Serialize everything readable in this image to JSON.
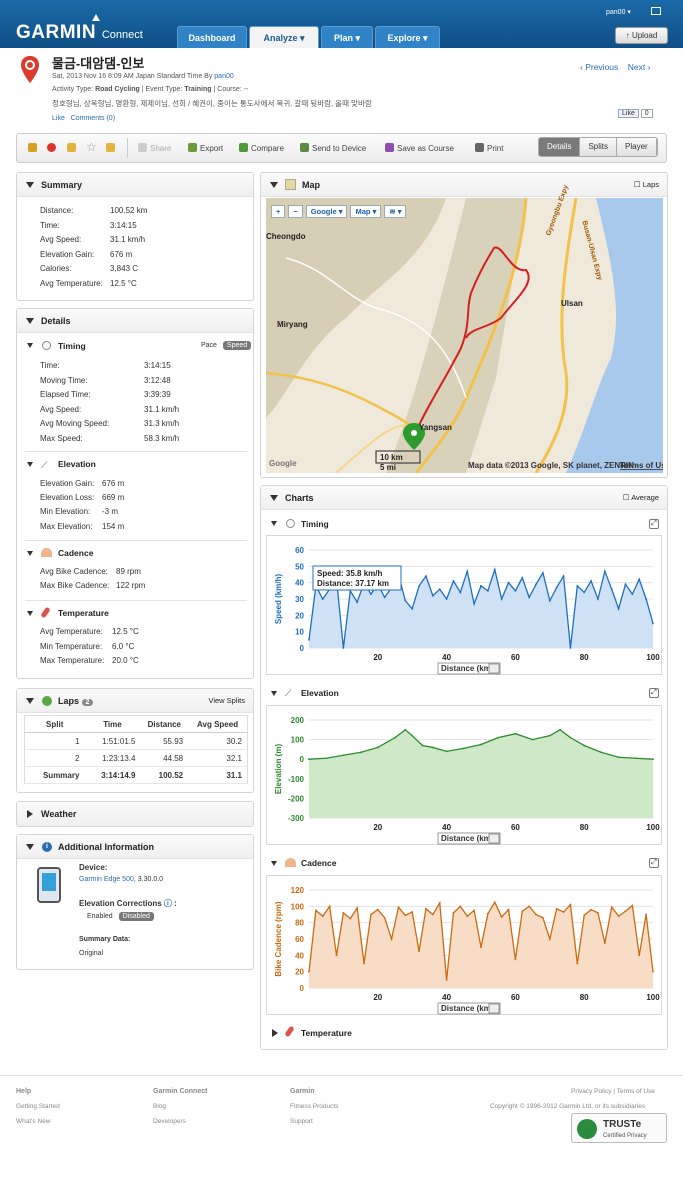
{
  "brand": {
    "name": "GARMIN",
    "product": "Connect"
  },
  "nav": [
    {
      "label": "Dashboard"
    },
    {
      "label": "Analyze"
    },
    {
      "label": "Plan"
    },
    {
      "label": "Explore"
    }
  ],
  "user": "pan00",
  "upload": "Upload",
  "activity": {
    "title": "물금-대암댐-인보",
    "date_line": "Sat, 2013 Nov 16 8:09 AM Japan Standard Time By",
    "owner": "pan00",
    "type_label": "Activity Type:",
    "type": "Road Cycling",
    "event_label": "| Event Type:",
    "event": "Training",
    "course": "| Course: --",
    "tags": "정호형님, 상옥형님, 명환형, 제제이님, 선희 / 혜권이, 중이는 통도사에서 복귀. 갈때 뒷바람, 올때 맞바람",
    "like": "Like",
    "comments": "Comments (0)",
    "prev": "Previous",
    "next": "Next",
    "fb_like": "Like",
    "fb_count": "0"
  },
  "toolbar": {
    "share": "Share",
    "export": "Export",
    "compare": "Compare",
    "send": "Send to Device",
    "save": "Save as Course",
    "print": "Print",
    "tabs": [
      "Details",
      "Splits",
      "Player"
    ]
  },
  "summary": {
    "title": "Summary",
    "rows": [
      {
        "k": "Distance:",
        "v": "100.52 km"
      },
      {
        "k": "Time:",
        "v": "3:14:15"
      },
      {
        "k": "Avg Speed:",
        "v": "31.1 km/h"
      },
      {
        "k": "Elevation Gain:",
        "v": "676 m"
      },
      {
        "k": "Calories:",
        "v": "3,843 C"
      },
      {
        "k": "Avg Temperature:",
        "v": "12.5 °C"
      }
    ]
  },
  "details": {
    "title": "Details",
    "timing": {
      "title": "Timing",
      "pace": "Pace",
      "speed": "Speed",
      "rows": [
        {
          "k": "Time:",
          "v": "3:14:15"
        },
        {
          "k": "Moving Time:",
          "v": "3:12:48"
        },
        {
          "k": "Elapsed Time:",
          "v": "3:39:39"
        },
        {
          "k": "Avg Speed:",
          "v": "31.1 km/h"
        },
        {
          "k": "Avg Moving Speed:",
          "v": "31.3 km/h"
        },
        {
          "k": "Max Speed:",
          "v": "58.3 km/h"
        }
      ]
    },
    "elevation": {
      "title": "Elevation",
      "rows": [
        {
          "k": "Elevation Gain:",
          "v": "676 m"
        },
        {
          "k": "Elevation Loss:",
          "v": "669 m"
        },
        {
          "k": "Min Elevation:",
          "v": "-3 m"
        },
        {
          "k": "Max Elevation:",
          "v": "154 m"
        }
      ]
    },
    "cadence": {
      "title": "Cadence",
      "rows": [
        {
          "k": "Avg Bike Cadence:",
          "v": "89 rpm"
        },
        {
          "k": "Max Bike Cadence:",
          "v": "122 rpm"
        }
      ]
    },
    "temperature": {
      "title": "Temperature",
      "rows": [
        {
          "k": "Avg Temperature:",
          "v": "12.5 °C"
        },
        {
          "k": "Min Temperature:",
          "v": "6.0 °C"
        },
        {
          "k": "Max Temperature:",
          "v": "20.0 °C"
        }
      ]
    }
  },
  "laps": {
    "title": "Laps",
    "count": "2",
    "view": "View Splits",
    "headers": [
      "Split",
      "Time",
      "Distance",
      "Avg Speed"
    ],
    "rows": [
      [
        "1",
        "1:51:01.5",
        "55.93",
        "30.2"
      ],
      [
        "2",
        "1:23:13.4",
        "44.58",
        "32.1"
      ],
      [
        "Summary",
        "3:14:14.9",
        "100.52",
        "31.1"
      ]
    ]
  },
  "weather": {
    "title": "Weather"
  },
  "additional": {
    "title": "Additional Information",
    "device_label": "Device:",
    "device": "Garmin Edge 500",
    "device_ver": ", 3.30.0.0",
    "elev_label": "Elevation Corrections",
    "enabled": "Enabled",
    "disabled": "Disabled",
    "summary_label": "Summary Data:",
    "summary_val": "Original"
  },
  "map": {
    "title": "Map",
    "laps": "Laps",
    "zoom_in": "+",
    "zoom_out": "−",
    "google": "Google",
    "map": "Map",
    "places": [
      "Cheongdo",
      "Miryang",
      "Ulsan",
      "Yangsan"
    ],
    "roads": [
      "Gyeongbu Expy",
      "Busan-Ulsan Expy"
    ],
    "scale_km": "10 km",
    "scale_mi": "5 mi",
    "credit": "Map data ©2013 Google, SK planet, ZENRIN -",
    "terms": "Terms of Use",
    "logo": "Google"
  },
  "charts": {
    "title": "Charts",
    "average": "Average",
    "temperature": "Temperature",
    "selector": "Distance (km)"
  },
  "chart_data": [
    {
      "type": "line",
      "title": "Timing",
      "ylabel": "Speed (km/h)",
      "xlabel": "Distance (km)",
      "color": "#1f6fbf",
      "fill": "#cfe2f5",
      "xlim": [
        0,
        100
      ],
      "ylim": [
        0,
        60
      ],
      "xticks": [
        20,
        40,
        60,
        80,
        100
      ],
      "yticks": [
        0,
        10,
        20,
        30,
        40,
        50,
        60
      ],
      "tooltip": {
        "speed": "Speed: 35.8 km/h",
        "distance": "Distance: 37.17 km"
      },
      "x": [
        0,
        2,
        4,
        6,
        8,
        10,
        12,
        14,
        16,
        18,
        20,
        22,
        24,
        26,
        28,
        30,
        32,
        34,
        36,
        38,
        40,
        42,
        44,
        46,
        48,
        50,
        52,
        54,
        56,
        58,
        60,
        62,
        64,
        66,
        68,
        70,
        72,
        74,
        76,
        78,
        80,
        82,
        84,
        86,
        88,
        90,
        92,
        94,
        96,
        98,
        100
      ],
      "y": [
        5,
        38,
        30,
        36,
        42,
        0,
        35,
        28,
        40,
        33,
        39,
        31,
        37,
        45,
        29,
        24,
        38,
        44,
        32,
        36,
        30,
        41,
        34,
        47,
        27,
        38,
        35,
        48,
        30,
        40,
        35,
        43,
        31,
        39,
        46,
        29,
        37,
        44,
        0,
        38,
        34,
        41,
        30,
        47,
        36,
        24,
        39,
        33,
        42,
        30,
        15
      ]
    },
    {
      "type": "area",
      "title": "Elevation",
      "ylabel": "Elevation (m)",
      "xlabel": "Distance (km)",
      "color": "#2e8b2e",
      "fill": "#cfe8c8",
      "xlim": [
        0,
        100
      ],
      "ylim": [
        -300,
        200
      ],
      "xticks": [
        20,
        40,
        60,
        80,
        100
      ],
      "yticks": [
        200,
        100,
        0,
        -100,
        -200,
        -300
      ],
      "x": [
        0,
        5,
        10,
        15,
        20,
        25,
        28,
        30,
        33,
        36,
        40,
        45,
        50,
        55,
        60,
        65,
        70,
        73,
        76,
        80,
        85,
        90,
        95,
        100
      ],
      "y": [
        0,
        5,
        20,
        35,
        60,
        110,
        150,
        120,
        70,
        60,
        40,
        55,
        75,
        110,
        130,
        100,
        120,
        150,
        110,
        70,
        35,
        10,
        5,
        0
      ]
    },
    {
      "type": "line",
      "title": "Cadence",
      "ylabel": "Bike Cadence (rpm)",
      "xlabel": "Distance (km)",
      "color": "#cc6a10",
      "fill": "#f7dcc6",
      "xlim": [
        0,
        100
      ],
      "ylim": [
        0,
        120
      ],
      "xticks": [
        20,
        40,
        60,
        80,
        100
      ],
      "yticks": [
        0,
        20,
        40,
        60,
        80,
        100,
        120
      ],
      "x": [
        0,
        2,
        4,
        6,
        8,
        10,
        12,
        14,
        16,
        18,
        20,
        22,
        24,
        26,
        28,
        30,
        32,
        34,
        36,
        38,
        40,
        42,
        44,
        46,
        48,
        50,
        52,
        54,
        56,
        58,
        60,
        62,
        64,
        66,
        68,
        70,
        72,
        74,
        76,
        78,
        80,
        82,
        84,
        86,
        88,
        90,
        92,
        94,
        96,
        98,
        100
      ],
      "y": [
        20,
        95,
        88,
        100,
        40,
        92,
        85,
        98,
        30,
        90,
        96,
        86,
        60,
        99,
        89,
        93,
        45,
        97,
        90,
        104,
        10,
        92,
        100,
        88,
        95,
        50,
        91,
        105,
        87,
        96,
        35,
        94,
        100,
        90,
        86,
        60,
        97,
        93,
        102,
        30,
        89,
        96,
        92,
        55,
        99,
        88,
        94,
        101,
        40,
        90,
        20
      ]
    }
  ],
  "footer": {
    "cols": [
      {
        "head": "Help",
        "links": [
          "Getting Started",
          "What's New"
        ]
      },
      {
        "head": "Garmin Connect",
        "links": [
          "Blog",
          "Developers"
        ]
      },
      {
        "head": "Garmin",
        "links": [
          "Fitness Products",
          "Support"
        ]
      }
    ],
    "legal": "Privacy Policy | Terms of Use",
    "copyright": "Copyright © 1996-2012 Garmin Ltd. or its subsidiaries",
    "truste": "TRUSTe",
    "truste_sub": "Certified Privacy"
  }
}
